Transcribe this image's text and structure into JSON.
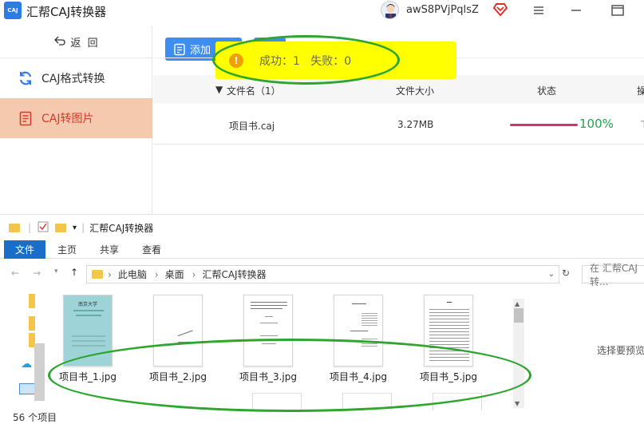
{
  "app": {
    "logo_text": "CAJ",
    "title": "汇帮CAJ转换器",
    "username": "awS8PVjPqlsZ",
    "back_label": "返  回",
    "nav": [
      {
        "label": "CAJ格式转换",
        "icon": "refresh-icon"
      },
      {
        "label": "CAJ转图片",
        "icon": "document-icon",
        "active": true
      }
    ],
    "add_button_label": "添加",
    "table": {
      "headers": {
        "name": "文件名（1）",
        "size": "文件大小",
        "status": "状态",
        "op": "操"
      },
      "rows": [
        {
          "name": "项目书.caj",
          "size": "3.27MB",
          "progress": 100,
          "progress_label": "100%"
        }
      ]
    },
    "toast": {
      "text": "成功：1   失败：0",
      "icon": "info-icon"
    },
    "colors": {
      "accent": "#3d8ef0",
      "active_bg": "#f5c9ad",
      "active_text": "#d83a2b",
      "progress": "#d6336c",
      "pct": "#1aa84a",
      "toast_bg": "#ffff00"
    }
  },
  "explorer": {
    "title": "汇帮CAJ转换器",
    "ribbon_tabs": [
      "文件",
      "主页",
      "共享",
      "查看"
    ],
    "path": [
      "此电脑",
      "桌面",
      "汇帮CAJ转换器"
    ],
    "search_placeholder": "在 汇帮CAJ转...",
    "files": [
      "项目书_1.jpg",
      "项目书_2.jpg",
      "项目书_3.jpg",
      "项目书_4.jpg",
      "项目书_5.jpg"
    ],
    "preview_hint": "选择要预览",
    "status": "56 个项目",
    "cover_title": "南京大学"
  }
}
